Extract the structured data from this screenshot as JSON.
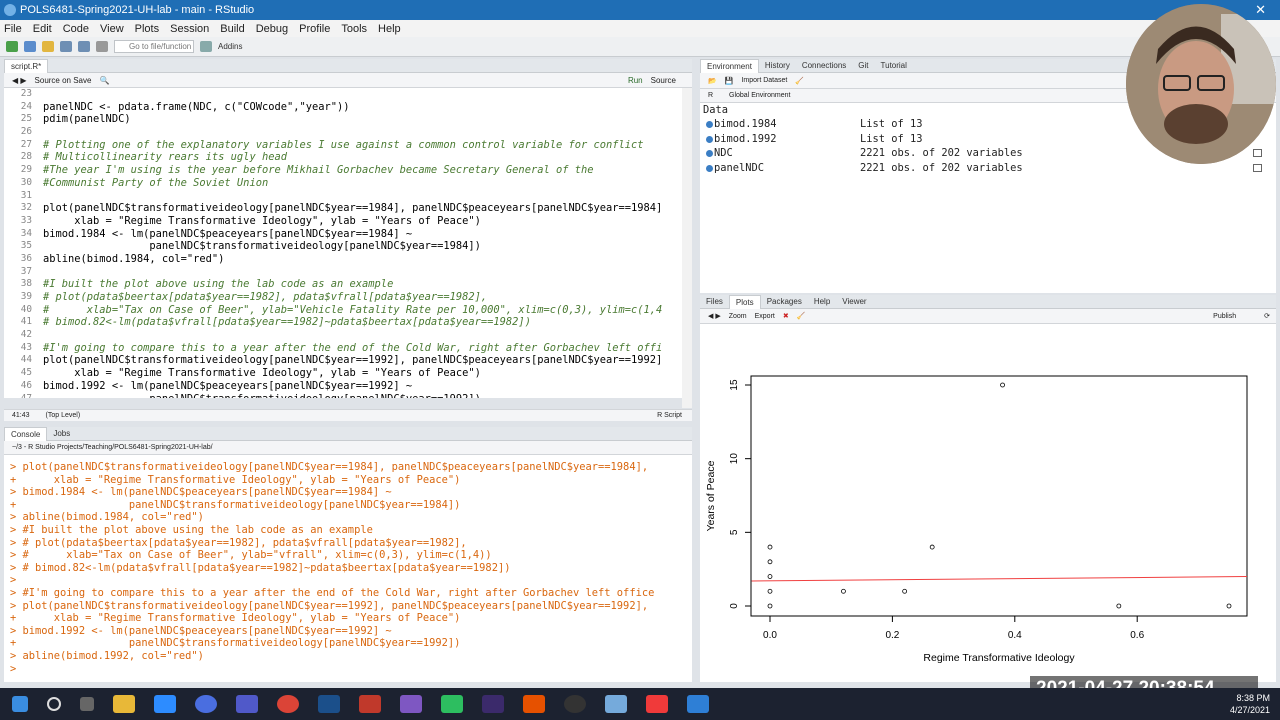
{
  "window": {
    "title": "POLS6481-Spring2021-UH-lab - main - RStudio"
  },
  "menu": [
    "File",
    "Edit",
    "Code",
    "View",
    "Plots",
    "Session",
    "Build",
    "Debug",
    "Profile",
    "Tools",
    "Help"
  ],
  "toolbar": {
    "goto_placeholder": "Go to file/function",
    "addins": "Addins"
  },
  "editor": {
    "tab": "script.R*",
    "source_on_save": "Source on Save",
    "run": "Run",
    "source": "Source",
    "cursor": "41:43",
    "scope": "(Top Level)",
    "filetype": "R Script",
    "lines": [
      {
        "n": "23",
        "t": "",
        "c": "code"
      },
      {
        "n": "24",
        "t": "panelNDC <- pdata.frame(NDC, c(\"COWcode\",\"year\"))",
        "c": "code"
      },
      {
        "n": "25",
        "t": "pdim(panelNDC)",
        "c": "code"
      },
      {
        "n": "26",
        "t": "",
        "c": "code"
      },
      {
        "n": "27",
        "t": "# Plotting one of the explanatory variables I use against a common control variable for conflict",
        "c": "cmt"
      },
      {
        "n": "28",
        "t": "# Multicollinearity rears its ugly head",
        "c": "cmt"
      },
      {
        "n": "29",
        "t": "#The year I'm using is the year before Mikhail Gorbachev became Secretary General of the",
        "c": "cmt"
      },
      {
        "n": "30",
        "t": "#Communist Party of the Soviet Union",
        "c": "cmt"
      },
      {
        "n": "31",
        "t": "",
        "c": "code"
      },
      {
        "n": "32",
        "t": "plot(panelNDC$transformativeideology[panelNDC$year==1984], panelNDC$peaceyears[panelNDC$year==1984]",
        "c": "code"
      },
      {
        "n": "33",
        "t": "     xlab = \"Regime Transformative Ideology\", ylab = \"Years of Peace\")",
        "c": "code"
      },
      {
        "n": "34",
        "t": "bimod.1984 <- lm(panelNDC$peaceyears[panelNDC$year==1984] ~",
        "c": "code"
      },
      {
        "n": "35",
        "t": "                 panelNDC$transformativeideology[panelNDC$year==1984])",
        "c": "code"
      },
      {
        "n": "36",
        "t": "abline(bimod.1984, col=\"red\")",
        "c": "code"
      },
      {
        "n": "37",
        "t": "",
        "c": "code"
      },
      {
        "n": "38",
        "t": "#I built the plot above using the lab code as an example",
        "c": "cmt"
      },
      {
        "n": "39",
        "t": "# plot(pdata$beertax[pdata$year==1982], pdata$vfrall[pdata$year==1982],",
        "c": "cmt"
      },
      {
        "n": "40",
        "t": "#      xlab=\"Tax on Case of Beer\", ylab=\"Vehicle Fatality Rate per 10,000\", xlim=c(0,3), ylim=c(1,4",
        "c": "cmt"
      },
      {
        "n": "41",
        "t": "# bimod.82<-lm(pdata$vfrall[pdata$year==1982]~pdata$beertax[pdata$year==1982])",
        "c": "cmt"
      },
      {
        "n": "42",
        "t": "",
        "c": "code"
      },
      {
        "n": "43",
        "t": "#I'm going to compare this to a year after the end of the Cold War, right after Gorbachev left offi",
        "c": "cmt"
      },
      {
        "n": "44",
        "t": "plot(panelNDC$transformativeideology[panelNDC$year==1992], panelNDC$peaceyears[panelNDC$year==1992]",
        "c": "code"
      },
      {
        "n": "45",
        "t": "     xlab = \"Regime Transformative Ideology\", ylab = \"Years of Peace\")",
        "c": "code"
      },
      {
        "n": "46",
        "t": "bimod.1992 <- lm(panelNDC$peaceyears[panelNDC$year==1992] ~",
        "c": "code"
      },
      {
        "n": "47",
        "t": "                 panelNDC$transformativeideology[panelNDC$year==1992])",
        "c": "code"
      }
    ]
  },
  "console": {
    "tabs": [
      "Console",
      "Jobs"
    ],
    "path": "~/3 - R Studio Projects/Teaching/POLS6481-Spring2021-UH-lab/",
    "lines": [
      "> plot(panelNDC$transformativeideology[panelNDC$year==1984], panelNDC$peaceyears[panelNDC$year==1984],",
      "+      xlab = \"Regime Transformative Ideology\", ylab = \"Years of Peace\")",
      "> bimod.1984 <- lm(panelNDC$peaceyears[panelNDC$year==1984] ~",
      "+                  panelNDC$transformativeideology[panelNDC$year==1984])",
      "> abline(bimod.1984, col=\"red\")",
      "> #I built the plot above using the lab code as an example",
      "> # plot(pdata$beertax[pdata$year==1982], pdata$vfrall[pdata$year==1982],",
      "> #      xlab=\"Tax on Case of Beer\", ylab=\"vfrall\", xlim=c(0,3), ylim=c(1,4))",
      "> # bimod.82<-lm(pdata$vfrall[pdata$year==1982]~pdata$beertax[pdata$year==1982])",
      ">",
      "> #I'm going to compare this to a year after the end of the Cold War, right after Gorbachev left office",
      "> plot(panelNDC$transformativeideology[panelNDC$year==1992], panelNDC$peaceyears[panelNDC$year==1992],",
      "+      xlab = \"Regime Transformative Ideology\", ylab = \"Years of Peace\")",
      "> bimod.1992 <- lm(panelNDC$peaceyears[panelNDC$year==1992] ~",
      "+                  panelNDC$transformativeideology[panelNDC$year==1992])",
      "> abline(bimod.1992, col=\"red\")",
      "> "
    ]
  },
  "environment": {
    "tabs": [
      "Environment",
      "History",
      "Connections",
      "Git",
      "Tutorial"
    ],
    "import": "Import Dataset",
    "scope_r": "R",
    "scope": "Global Environment",
    "header": "Data",
    "rows": [
      {
        "name": "bimod.1984",
        "value": "List of  13",
        "grid": false
      },
      {
        "name": "bimod.1992",
        "value": "List of  13",
        "grid": false
      },
      {
        "name": "NDC",
        "value": "2221 obs. of 202 variables",
        "grid": true
      },
      {
        "name": "panelNDC",
        "value": "2221 obs. of 202 variables",
        "grid": true
      }
    ]
  },
  "plots": {
    "tabs": [
      "Files",
      "Plots",
      "Packages",
      "Help",
      "Viewer"
    ],
    "zoom": "Zoom",
    "export": "Export",
    "publish": "Publish"
  },
  "chart_data": {
    "type": "scatter",
    "xlabel": "Regime Transformative Ideology",
    "ylabel": "Years of Peace",
    "xlim": [
      0,
      0.75
    ],
    "ylim": [
      0,
      15
    ],
    "xticks": [
      "0.0",
      "0.2",
      "0.4",
      "0.6"
    ],
    "xtick_values": [
      0,
      0.2,
      0.4,
      0.6
    ],
    "yticks": [
      "0",
      "5",
      "10",
      "15"
    ],
    "ytick_values": [
      0,
      5,
      10,
      15
    ],
    "points": [
      {
        "x": 0.0,
        "y": 0
      },
      {
        "x": 0.0,
        "y": 1
      },
      {
        "x": 0.0,
        "y": 2
      },
      {
        "x": 0.0,
        "y": 3
      },
      {
        "x": 0.0,
        "y": 4
      },
      {
        "x": 0.12,
        "y": 1
      },
      {
        "x": 0.22,
        "y": 1
      },
      {
        "x": 0.265,
        "y": 4
      },
      {
        "x": 0.38,
        "y": 15
      },
      {
        "x": 0.57,
        "y": 0
      },
      {
        "x": 0.75,
        "y": 0
      }
    ],
    "fit_line": {
      "x0": -0.03,
      "y0": 1.7,
      "x1": 0.78,
      "y1": 2.0,
      "color": "#f04040"
    }
  },
  "timestamp": "2021-04-27 20:38:54",
  "clock": {
    "time": "8:38 PM",
    "date": "4/27/2021"
  },
  "colors": {
    "titlebar": "#1f6eb5",
    "console_text": "#d9670f",
    "comment": "#4a7a32"
  }
}
